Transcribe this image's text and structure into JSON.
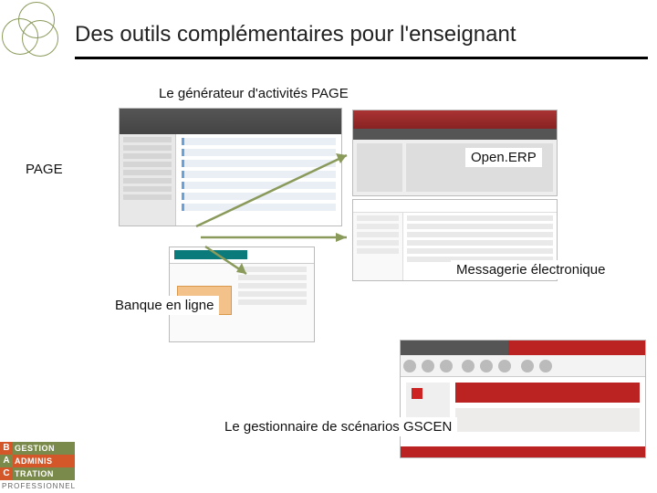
{
  "title": "Des outils complémentaires pour l'enseignant",
  "labels": {
    "generator": "Le générateur d'activités PAGE",
    "openerp": "Open.ERP",
    "page": "PAGE",
    "mail": "Messagerie électronique",
    "bank": "Banque en ligne",
    "gscen": "Le gestionnaire de scénarios GSCEN"
  },
  "logo": {
    "line1_letter": "B",
    "line1_text": "GESTION",
    "line2_letter": "A",
    "line2_text": "ADMINIS",
    "line3_letter": "C",
    "line3_text": "TRATION",
    "subtitle": "PROFESSIONNEL"
  }
}
